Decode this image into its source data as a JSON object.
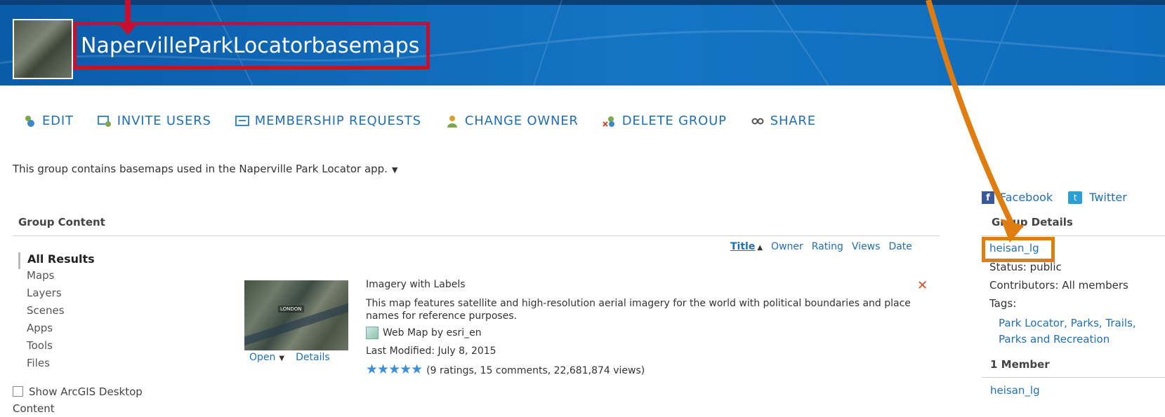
{
  "header": {
    "group_title": "NapervilleParkLocatorbasemaps"
  },
  "toolbar": [
    {
      "label": "EDIT",
      "icon": "edit-icon"
    },
    {
      "label": "INVITE USERS",
      "icon": "invite-users-icon"
    },
    {
      "label": "MEMBERSHIP REQUESTS",
      "icon": "membership-requests-icon"
    },
    {
      "label": "CHANGE OWNER",
      "icon": "change-owner-icon"
    },
    {
      "label": "DELETE GROUP",
      "icon": "delete-group-icon"
    },
    {
      "label": "SHARE",
      "icon": "share-icon"
    }
  ],
  "description": "This group contains basemaps used in the Naperville Park Locator app.",
  "content": {
    "heading": "Group Content",
    "sort": {
      "title": "Title",
      "owner": "Owner",
      "rating": "Rating",
      "views": "Views",
      "date": "Date"
    },
    "facets": {
      "all": "All Results",
      "items": [
        "Maps",
        "Layers",
        "Scenes",
        "Apps",
        "Tools",
        "Files"
      ]
    },
    "show_desktop": {
      "line1": "Show ArcGIS Desktop",
      "line2": "Content"
    },
    "item": {
      "title": "Imagery with Labels",
      "description": "This map features satellite and high-resolution aerial imagery for the world with political boundaries and place names for reference purposes.",
      "type": "Web Map by esri_en",
      "modified": "Last Modified: July 8, 2015",
      "stars": "★★★★★",
      "rating_text": "(9 ratings, 15 comments, 22,681,874 views)",
      "open": "Open",
      "details": "Details",
      "thumb_label": "LONDON",
      "remove_glyph": "✕"
    }
  },
  "sidebar": {
    "facebook": "Facebook",
    "twitter": "Twitter",
    "details_heading": "Group Details",
    "owner": "heisan_lg",
    "status": "Status: public",
    "contributors": "Contributors: All members",
    "tags_label": "Tags:",
    "tags": "Park Locator, Parks, Trails, Parks and Recreation",
    "members_heading": "1 Member",
    "member": "heisan_lg"
  },
  "colors": {
    "banner": "#1474c4",
    "link": "#1f6fb5",
    "annotation_red": "#c8102e",
    "annotation_orange": "#e07d10"
  }
}
